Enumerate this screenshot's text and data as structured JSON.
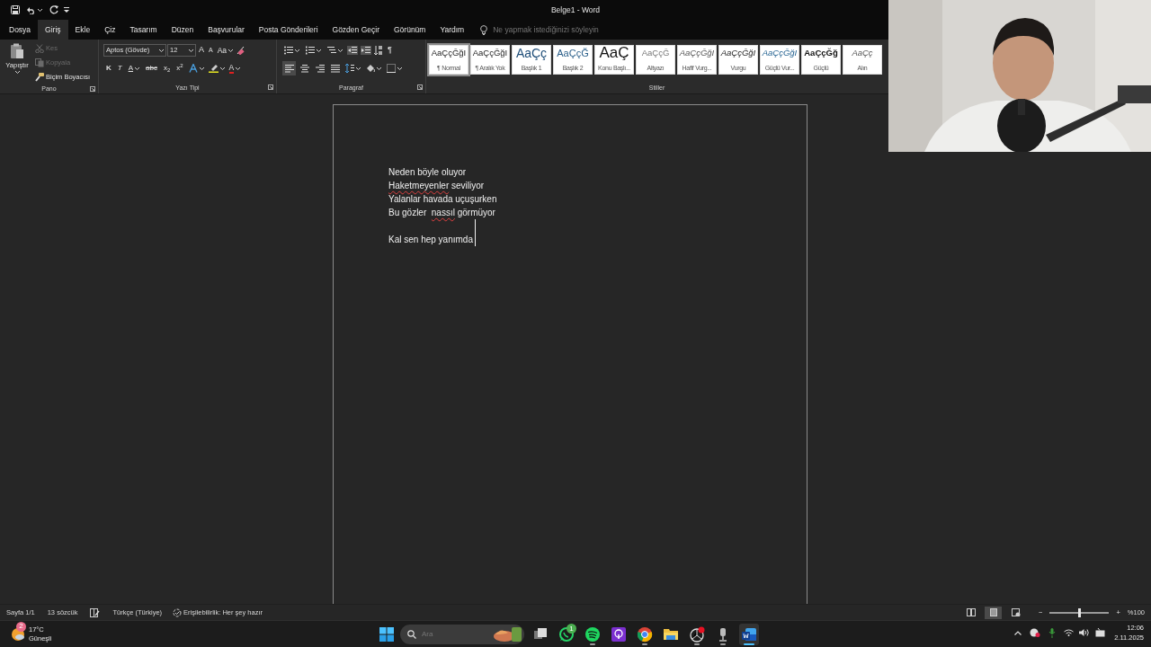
{
  "window": {
    "title": "Belge1 - Word"
  },
  "tabs": [
    {
      "label": "Dosya",
      "selected": false
    },
    {
      "label": "Giriş",
      "selected": true
    },
    {
      "label": "Ekle",
      "selected": false
    },
    {
      "label": "Çiz",
      "selected": false
    },
    {
      "label": "Tasarım",
      "selected": false
    },
    {
      "label": "Düzen",
      "selected": false
    },
    {
      "label": "Başvurular",
      "selected": false
    },
    {
      "label": "Posta Gönderileri",
      "selected": false
    },
    {
      "label": "Gözden Geçir",
      "selected": false
    },
    {
      "label": "Görünüm",
      "selected": false
    },
    {
      "label": "Yardım",
      "selected": false
    }
  ],
  "tell_me": {
    "placeholder": "Ne yapmak istediğinizi söyleyin"
  },
  "clipboard": {
    "label": "Pano",
    "paste": "Yapıştır",
    "items": [
      {
        "label": "Kes",
        "kind": "cut",
        "disabled": true
      },
      {
        "label": "Kopyala",
        "kind": "copy",
        "disabled": true
      },
      {
        "label": "Biçim Boyacısı",
        "kind": "painter",
        "disabled": false
      }
    ]
  },
  "font": {
    "label": "Yazı Tipi",
    "font_name": "Aptos (Gövde)",
    "font_size": "12",
    "row1": [
      {
        "label": "A",
        "kind": "grow"
      },
      {
        "label": "A",
        "kind": "shrink"
      },
      {
        "label": "Aa",
        "kind": "case"
      }
    ],
    "row2": [
      {
        "label": "K",
        "kind": "bold"
      },
      {
        "label": "T",
        "kind": "italic"
      },
      {
        "label": "A",
        "kind": "underline"
      },
      {
        "label": "abc",
        "kind": "strike"
      },
      {
        "label": "x$_{2}$",
        "kind": "sub"
      },
      {
        "label": "x$^{2}$",
        "kind": "sup"
      }
    ],
    "font_color": "A"
  },
  "paragraph": {
    "label": "Paragraf",
    "pilcrow": "¶",
    "alignments": [
      {
        "kind": "left",
        "selected": true
      },
      {
        "kind": "center",
        "selected": false
      },
      {
        "kind": "right",
        "selected": false
      },
      {
        "kind": "justify",
        "selected": false
      }
    ]
  },
  "styles": {
    "label": "Stiller",
    "items": [
      {
        "preview": "AaÇçĞğI",
        "name": "¶ Normal",
        "kind": "normal",
        "selected": true
      },
      {
        "preview": "AaÇçĞğI",
        "name": "¶ Aralık Yok",
        "kind": "nospacing",
        "selected": false
      },
      {
        "preview": "AaÇç",
        "name": "Başlık 1",
        "kind": "heading1",
        "selected": false
      },
      {
        "preview": "AaÇçĞ",
        "name": "Başlık 2",
        "kind": "heading2",
        "selected": false
      },
      {
        "preview": "AaÇ",
        "name": "Konu Başlı...",
        "kind": "title",
        "selected": false
      },
      {
        "preview": "AaÇçĞ",
        "name": "Altyazı",
        "kind": "subtitle",
        "selected": false
      },
      {
        "preview": "AaÇçĞğI",
        "name": "Hafif Vurg...",
        "kind": "subtle",
        "selected": false
      },
      {
        "preview": "AaÇçĞğI",
        "name": "Vurgu",
        "kind": "emphasis",
        "selected": false
      },
      {
        "preview": "AaÇçĞğI",
        "name": "Güçlü Vur...",
        "kind": "intense",
        "selected": false
      },
      {
        "preview": "AaÇçĞğ",
        "name": "Güçlü",
        "kind": "strong",
        "selected": false
      },
      {
        "preview": "AaÇç",
        "name": "Alın",
        "kind": "quote",
        "selected": false
      }
    ]
  },
  "document": {
    "paragraphs": [
      {
        "segments": [
          {
            "text": "Neden böyle oluyor",
            "misspelled": false
          }
        ],
        "space_before": false,
        "cursor": false
      },
      {
        "segments": [
          {
            "text": "Haketmeyenler",
            "misspelled": true
          },
          {
            "text": " seviliyor",
            "misspelled": false
          }
        ],
        "space_before": false,
        "cursor": false
      },
      {
        "segments": [
          {
            "text": "Yalanlar havada uçuşurken",
            "misspelled": false
          }
        ],
        "space_before": false,
        "cursor": false
      },
      {
        "segments": [
          {
            "text": "Bu gözler  ",
            "misspelled": false
          },
          {
            "text": "nassıl",
            "misspelled": true
          },
          {
            "text": " görmüyor",
            "misspelled": false
          }
        ],
        "space_before": false,
        "cursor": false
      },
      {
        "segments": [
          {
            "text": "Kal sen hep yanımda",
            "misspelled": false
          }
        ],
        "space_before": true,
        "cursor": true
      }
    ]
  },
  "status_bar": {
    "page": "Sayfa 1/1",
    "words": "13 sözcük",
    "language": "Türkçe (Türkiye)",
    "accessibility": "Erişilebilirlik: Her şey hazır",
    "views": [
      {
        "kind": "read",
        "selected": false
      },
      {
        "kind": "print",
        "selected": true
      },
      {
        "kind": "web",
        "selected": false
      }
    ],
    "zoom_out": "−",
    "zoom_in": "+",
    "zoom": {
      "level": 0.5
    },
    "zoom_text": "%100"
  },
  "taskbar": {
    "weather": {
      "temperature": "17°C",
      "condition": "Güneşli",
      "badge": "2"
    },
    "search": {
      "placeholder": "Ara"
    },
    "apps": [
      {
        "kind": "taskview",
        "running": false,
        "active": false
      },
      {
        "kind": "chat",
        "running": false,
        "active": false,
        "badge": "1"
      },
      {
        "kind": "music",
        "running": true,
        "active": false
      },
      {
        "kind": "podcast",
        "running": false,
        "active": false
      },
      {
        "kind": "browser",
        "running": true,
        "active": false
      },
      {
        "kind": "folder",
        "running": false,
        "active": false
      },
      {
        "kind": "recorder",
        "running": true,
        "active": false
      },
      {
        "kind": "mic",
        "running": true,
        "active": false
      },
      {
        "kind": "word",
        "running": true,
        "active": true
      }
    ],
    "time": "12:06",
    "date": "2.11.2025"
  }
}
